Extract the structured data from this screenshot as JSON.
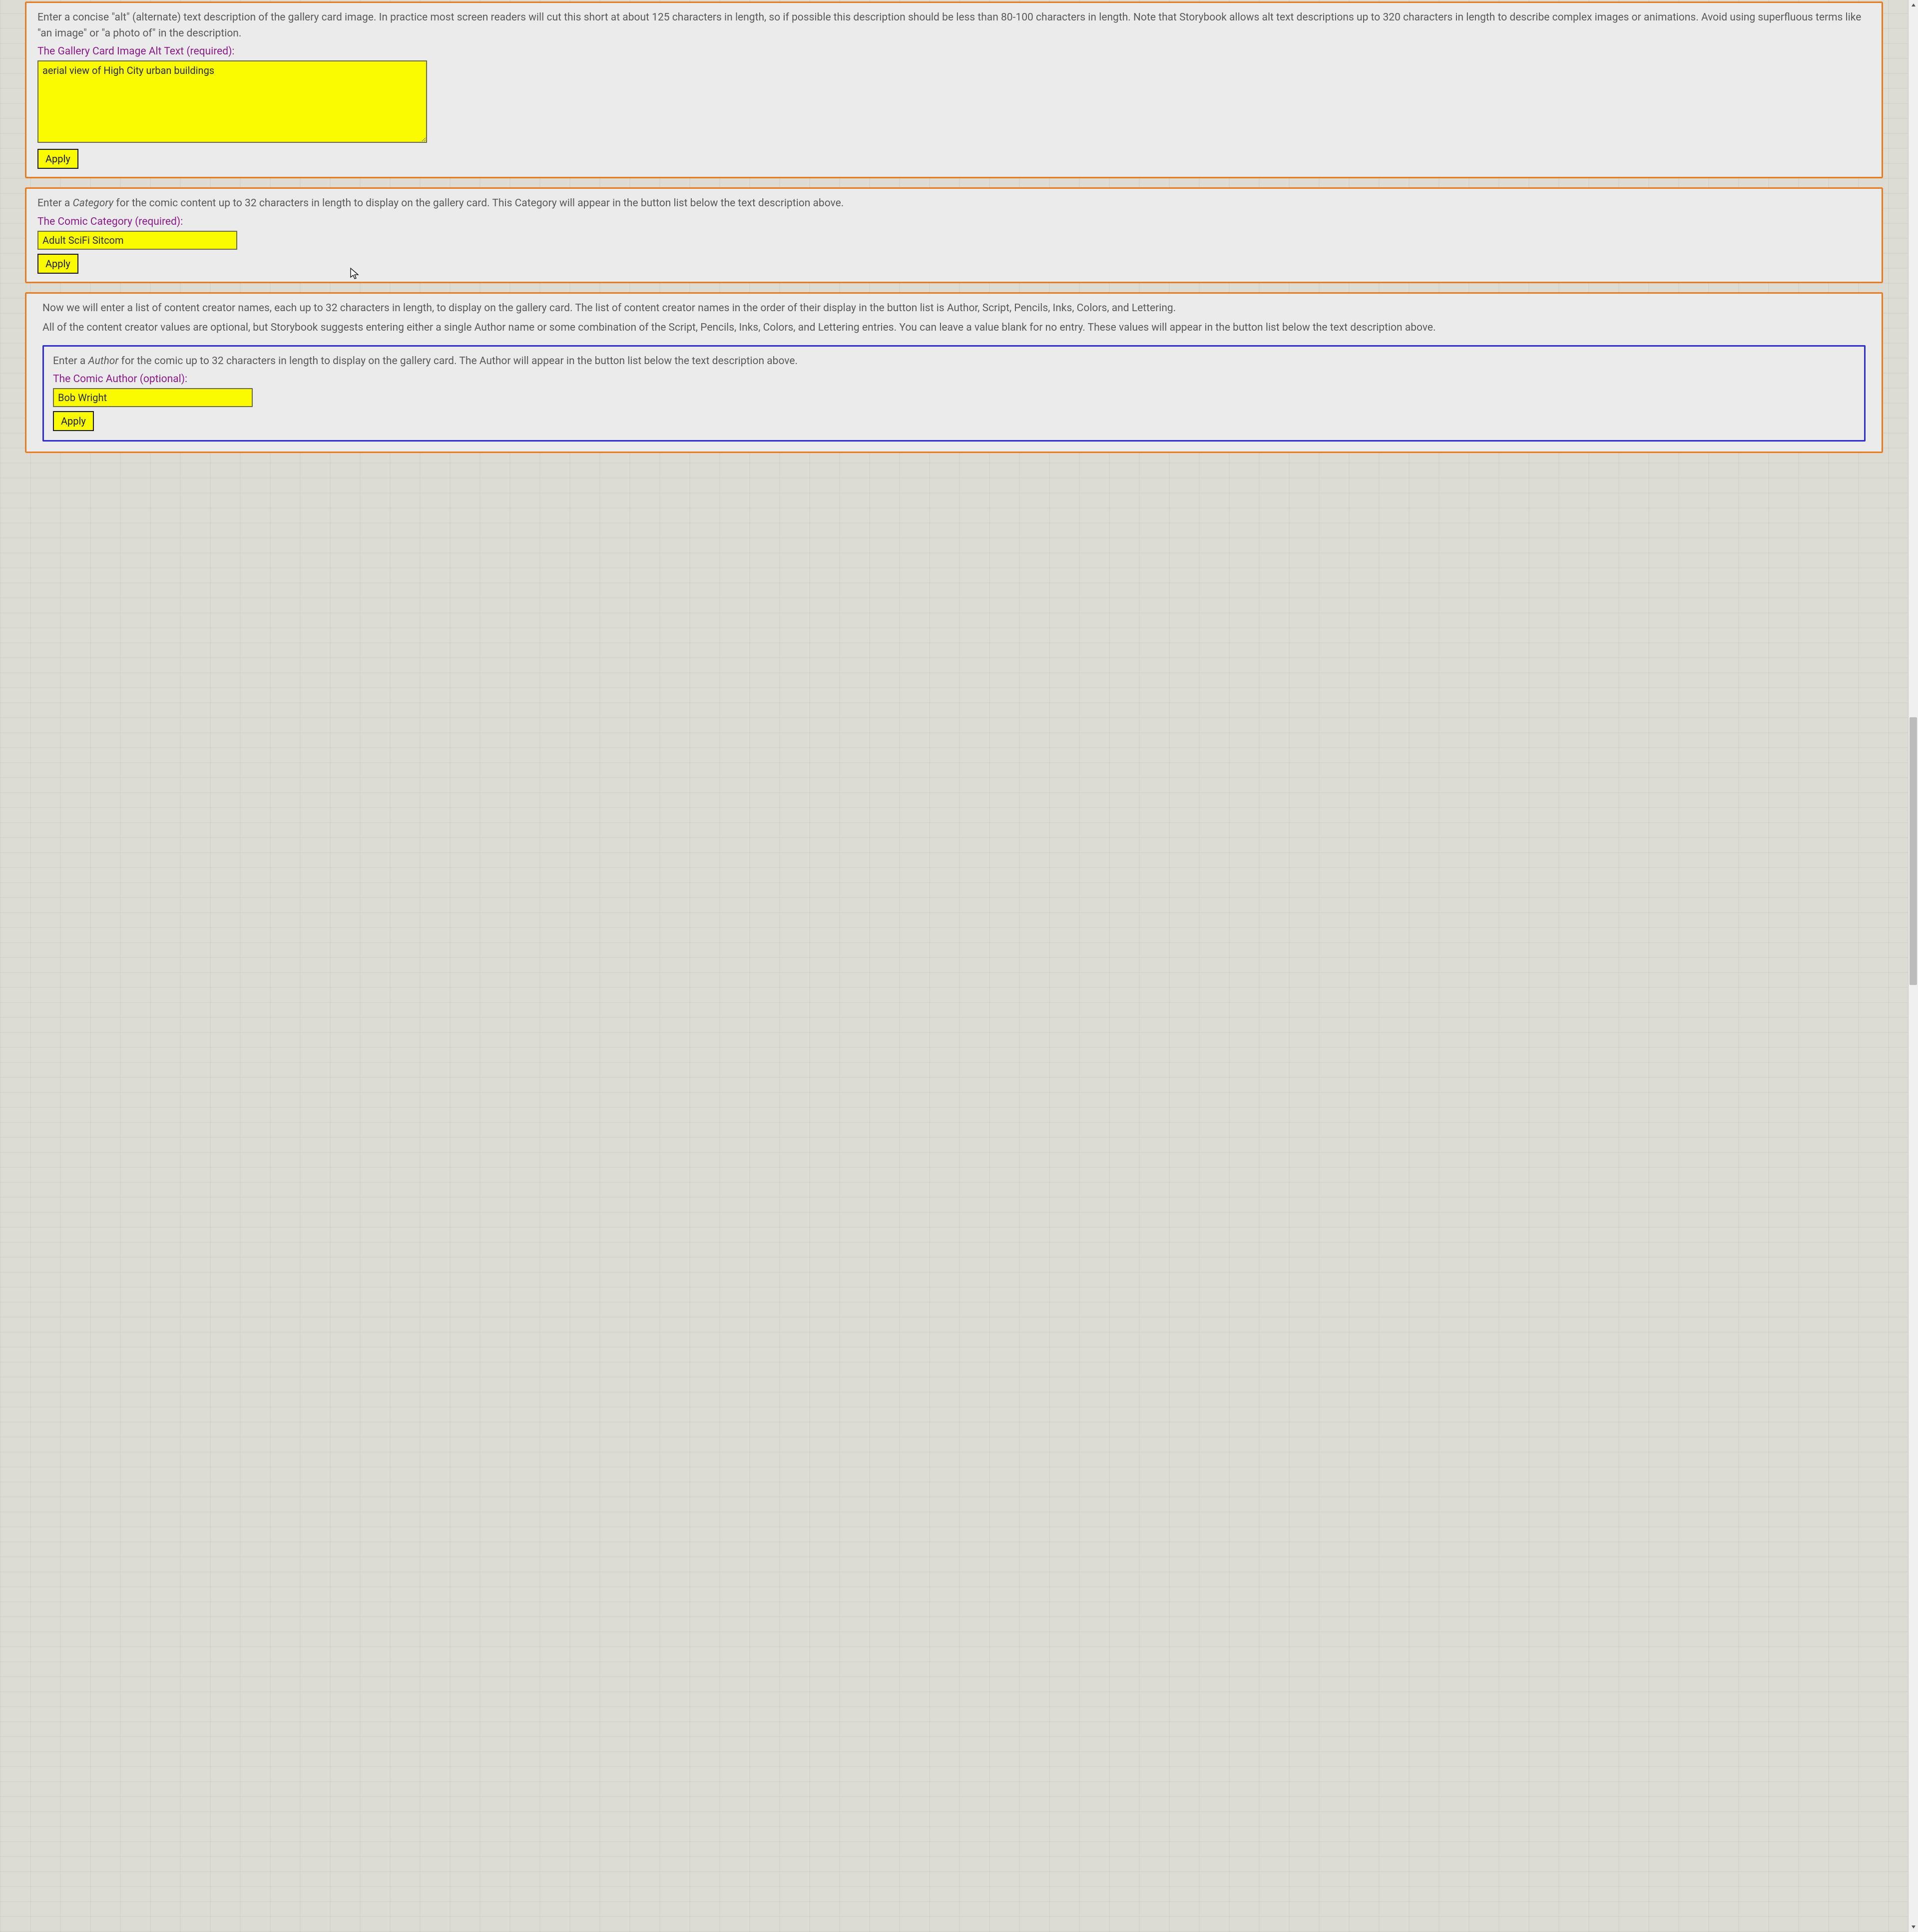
{
  "altTextCard": {
    "desc": "Enter a concise \"alt\" (alternate) text description of the gallery card image. In practice most screen readers will cut this short at about 125 characters in length, so if possible this description should be less than 80-100 characters in length. Note that Storybook allows alt text descriptions up to 320 characters in length to describe complex images or animations. Avoid using superfluous terms like \"an image\" or \"a photo of\" in the description.",
    "label": "The Gallery Card Image Alt Text (required):",
    "value": "aerial view of High City urban buildings",
    "apply": "Apply"
  },
  "categoryCard": {
    "desc_pre": "Enter a ",
    "desc_em": "Category",
    "desc_post": " for the comic content up to 32 characters in length to display on the gallery card. This Category will appear in the button list below the text description above.",
    "label": "The Comic Category (required):",
    "value": "Adult SciFi Sitcom",
    "apply": "Apply"
  },
  "creatorsCard": {
    "desc1": "Now we will enter a list of content creator names, each up to 32 characters in length, to display on the gallery card. The list of content creator names in the order of their display in the button list is Author, Script, Pencils, Inks, Colors, and Lettering.",
    "desc2": "All of the content creator values are optional, but Storybook suggests entering either a single Author name or some combination of the Script, Pencils, Inks, Colors, and Lettering entries. You can leave a value blank for no entry. These values will appear in the button list below the text description above.",
    "author": {
      "desc_pre": "Enter a ",
      "desc_em": "Author",
      "desc_post": " for the comic up to 32 characters in length to display on the gallery card. The Author will appear in the button list below the text description above.",
      "label": "The Comic Author (optional):",
      "value": "Bob Wright",
      "apply": "Apply"
    }
  }
}
